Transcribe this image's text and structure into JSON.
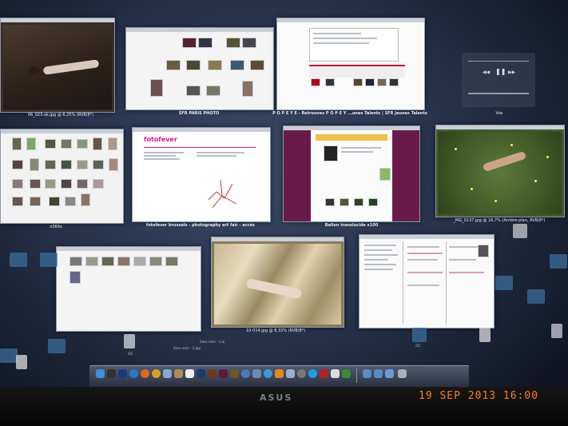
{
  "windows": {
    "w1": {
      "title": "06_023.ok.jpg @ 6,25% (RVB/8*)"
    },
    "w2": {
      "title": "SFR PARIS PHOTO"
    },
    "w3": {
      "title": "P O P E Y E - Retrouvez P O P E Y ...unes Talents | SFR Jeunes Talents"
    },
    "w4": {
      "title": "x36lts"
    },
    "w5": {
      "title": "fotofever brussels - photography art fair - accès",
      "logo": "fotofever"
    },
    "w6": {
      "title": "Ballon translucide x100"
    },
    "w7": {
      "title": "_MG_0137.jpg @ 16,7% (Arrière-plan, RVB/8*)"
    },
    "w9": {
      "title": "10-014.jpg @ 8,33% (RVB/8*)"
    },
    "w11": {
      "title": "Vox"
    }
  },
  "desktop_labels": [
    "SIC",
    "Sans nom - 1.ai",
    "Sans nom - 2.jpg",
    "ZIC"
  ],
  "colors": {
    "desktop_bg": "#26334b",
    "date_stamp": "#ff7a1a",
    "bezel": "#0a0a0a"
  },
  "monitor": {
    "brand": "ASUS"
  },
  "date_stamp": "19 SEP 2013 16:00"
}
